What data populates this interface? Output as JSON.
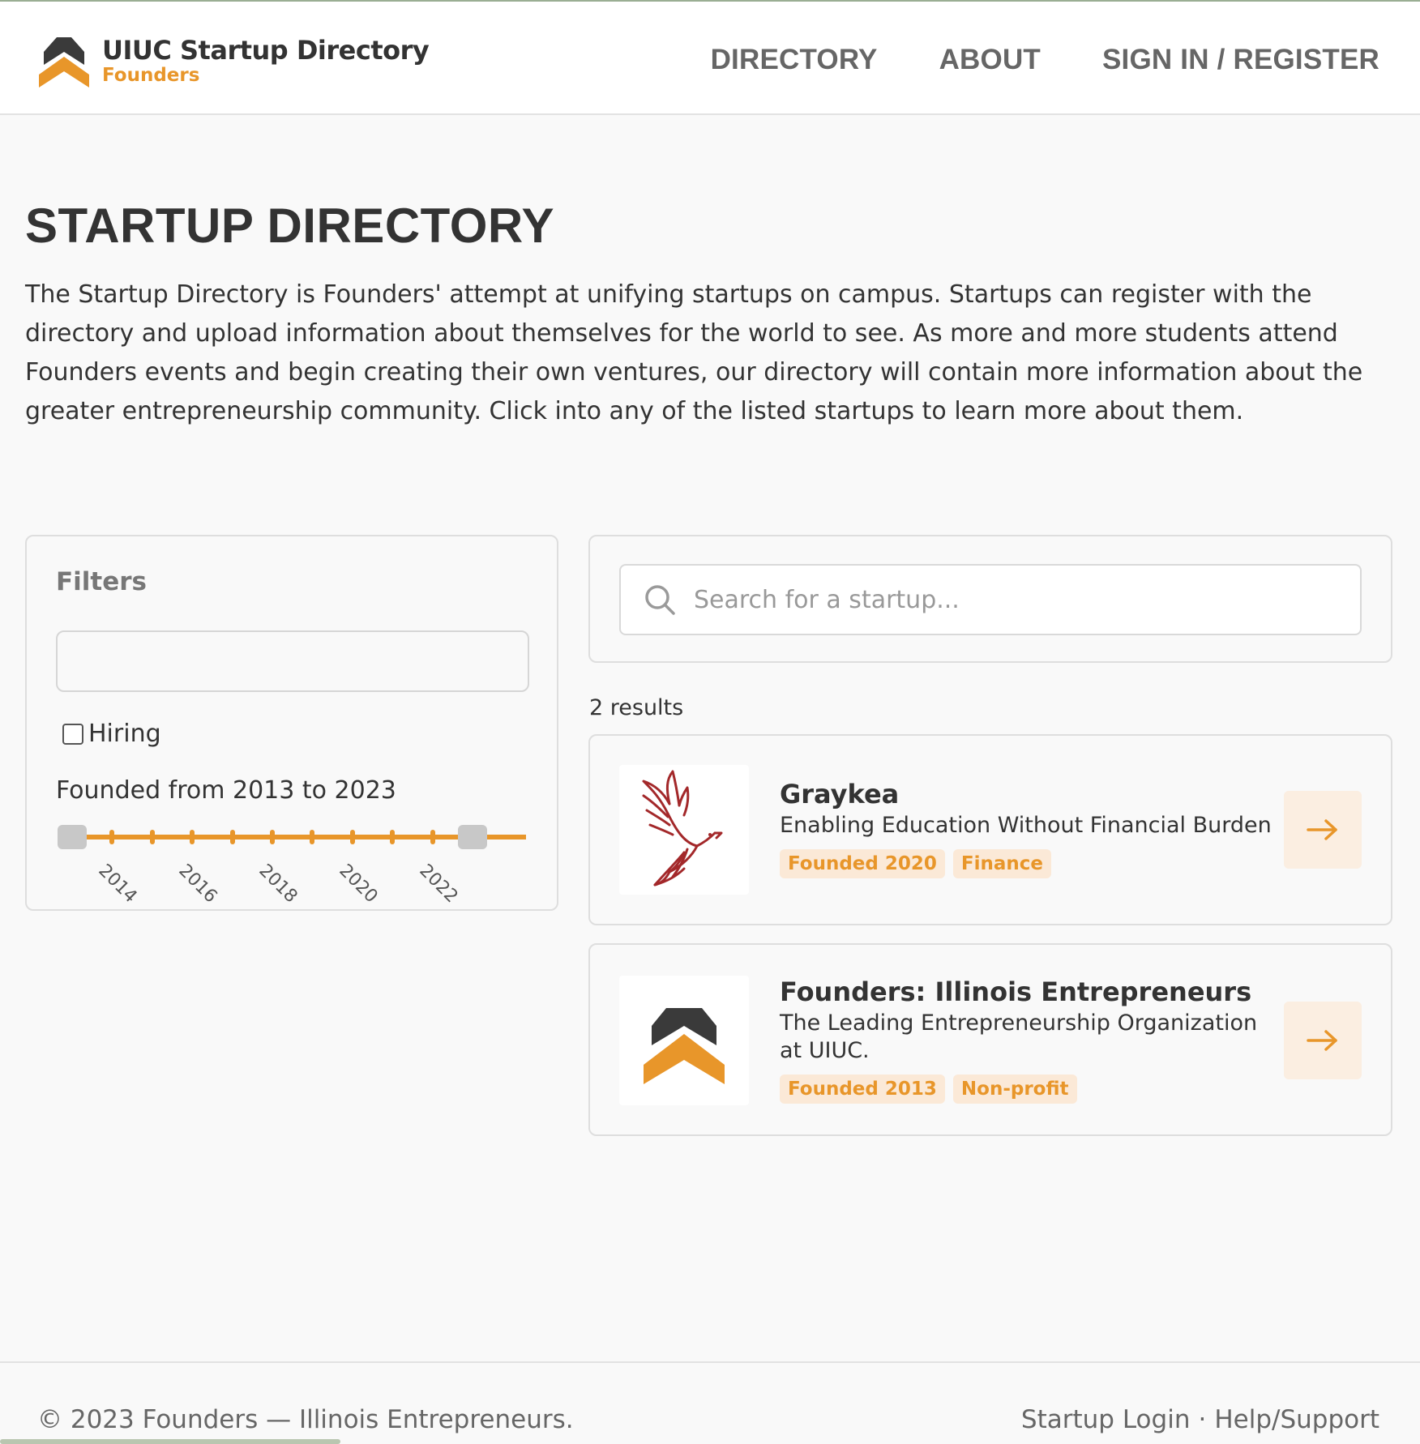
{
  "brand": {
    "title": "UIUC Startup Directory",
    "subtitle": "Founders"
  },
  "nav": {
    "directory": "DIRECTORY",
    "about": "ABOUT",
    "signin": "SIGN IN / REGISTER"
  },
  "page": {
    "title": "STARTUP DIRECTORY",
    "intro": "The Startup Directory is Founders' attempt at unifying startups on campus. Startups can register with the directory and upload information about themselves for the world to see. As more and more students attend Founders events and begin creating their own ventures, our directory will contain more information about the greater entrepreneurship community. Click into any of the listed startups to learn more about them."
  },
  "filters": {
    "title": "Filters",
    "input_value": "",
    "hiring_label": "Hiring",
    "hiring_checked": false,
    "founded_label": "Founded from 2013 to 2023",
    "range_min": 2013,
    "range_max": 2023,
    "tick_labels": [
      "2014",
      "2016",
      "2018",
      "2020",
      "2022"
    ]
  },
  "search": {
    "placeholder": "Search for a startup...",
    "value": ""
  },
  "results": {
    "count_label": "2 results",
    "items": [
      {
        "name": "Graykea",
        "tagline": "Enabling Education Without Financial Burden",
        "tags": [
          "Founded 2020",
          "Finance"
        ],
        "logo_icon": "dove-icon"
      },
      {
        "name": "Founders: Illinois Entrepreneurs",
        "tagline": "The Leading Entrepreneurship Organization at UIUC.",
        "tags": [
          "Founded 2013",
          "Non-profit"
        ],
        "logo_icon": "founders-chevron-icon"
      }
    ]
  },
  "footer": {
    "copyright": "© 2023 Founders — Illinois Entrepreneurs.",
    "startup_login": "Startup Login",
    "separator": "·",
    "help": "Help/Support"
  },
  "colors": {
    "accent": "#e8962a",
    "dark": "#3a3a3a",
    "tag_bg": "#fbe9d7",
    "dove": "#a3282a"
  }
}
